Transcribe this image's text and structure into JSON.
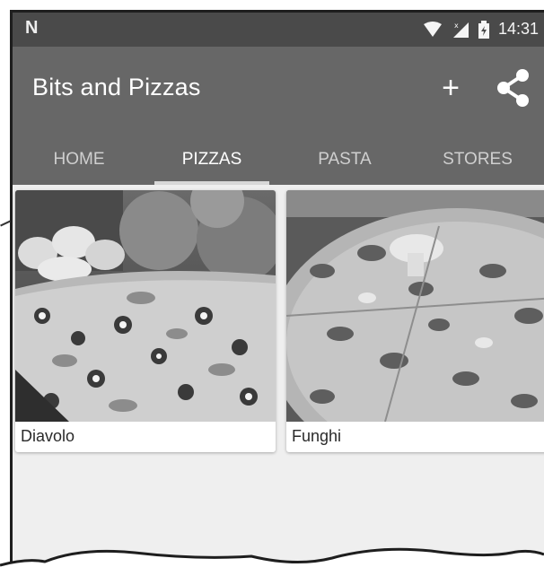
{
  "status_bar": {
    "carrier_icon": "n-logo",
    "time": "14:31",
    "icons": [
      "wifi-icon",
      "signal-icon",
      "battery-icon"
    ]
  },
  "app_bar": {
    "title": "Bits and Pizzas",
    "add_icon": "plus-icon",
    "share_icon": "share-icon",
    "add_glyph": "+"
  },
  "tabs": [
    {
      "label": "HOME",
      "active": false
    },
    {
      "label": "PIZZAS",
      "active": true
    },
    {
      "label": "PASTA",
      "active": false
    },
    {
      "label": "STORES",
      "active": false
    }
  ],
  "pizzas": [
    {
      "name": "Diavolo"
    },
    {
      "name": "Funghi"
    }
  ],
  "colors": {
    "status_bar": "#4a4a4a",
    "app_bar": "#676767",
    "tab_indicator": "#d8d8d8",
    "background": "#efefef"
  }
}
